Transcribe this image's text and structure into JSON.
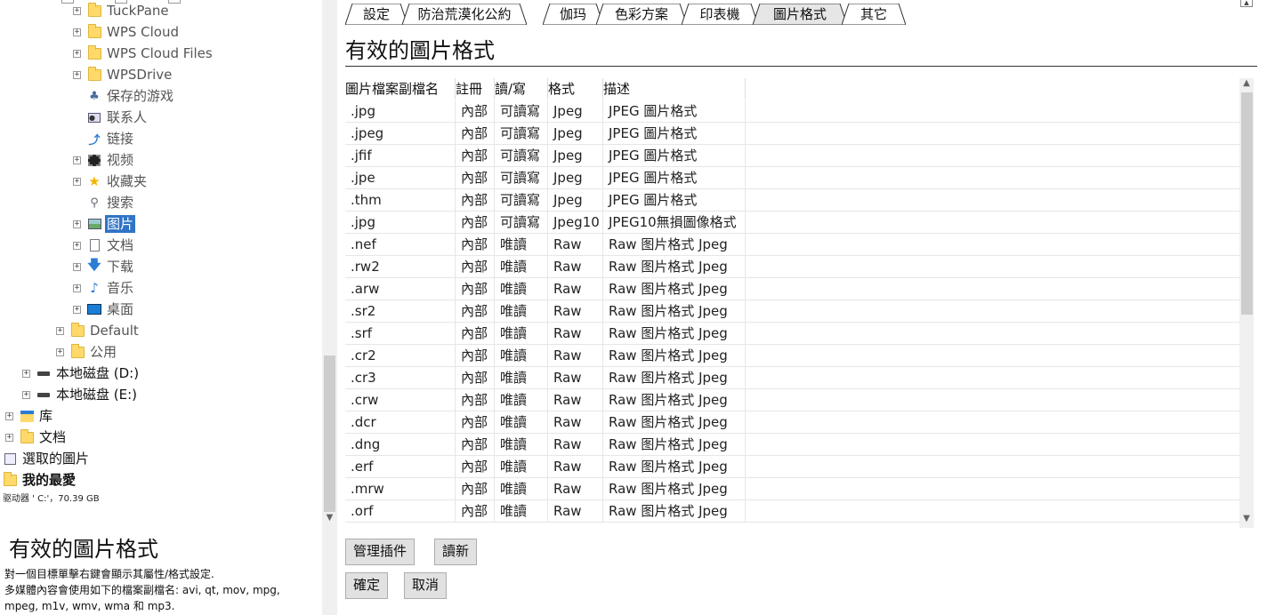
{
  "tree": {
    "items": [
      {
        "label": "TuckPane",
        "icon": "folder-icon"
      },
      {
        "label": "WPS Cloud",
        "icon": "folder-icon"
      },
      {
        "label": "WPS Cloud Files",
        "icon": "folder-icon"
      },
      {
        "label": "WPSDrive",
        "icon": "folder-icon"
      },
      {
        "label": "保存的游戏",
        "icon": "saved-games-icon"
      },
      {
        "label": "联系人",
        "icon": "contacts-icon"
      },
      {
        "label": "链接",
        "icon": "links-icon"
      },
      {
        "label": "视频",
        "icon": "videos-icon"
      },
      {
        "label": "收藏夹",
        "icon": "favorites-star-icon"
      },
      {
        "label": "搜索",
        "icon": "search-icon"
      },
      {
        "label": "图片",
        "icon": "pictures-icon"
      },
      {
        "label": "文档",
        "icon": "documents-icon"
      },
      {
        "label": "下载",
        "icon": "download-icon"
      },
      {
        "label": "音乐",
        "icon": "music-icon"
      },
      {
        "label": "桌面",
        "icon": "desktop-icon"
      },
      {
        "label": "Default",
        "icon": "folder-icon"
      },
      {
        "label": "公用",
        "icon": "folder-icon"
      },
      {
        "label": "本地磁盘 (D:)",
        "icon": "drive-icon"
      },
      {
        "label": "本地磁盘 (E:)",
        "icon": "drive-icon"
      },
      {
        "label": "库",
        "icon": "library-icon"
      },
      {
        "label": "文档",
        "icon": "folder-icon"
      },
      {
        "label": "選取的圖片",
        "icon": "selected-pictures-icon"
      },
      {
        "label": "我的最愛",
        "icon": "folder-icon"
      }
    ],
    "drive_info": "驱动器 ' C:'，70.39 GB"
  },
  "description": {
    "title": "有效的圖片格式",
    "line1": "對一個目標單擊右鍵會顯示其屬性/格式設定.",
    "line2": "多媒體內容會使用如下的檔案副檔名: avi, qt, mov, mpg,",
    "line3": "mpeg, m1v, wmv, wma 和 mp3."
  },
  "tabs": [
    {
      "label": "設定"
    },
    {
      "label": "防治荒漠化公約"
    },
    {
      "label": "伽玛"
    },
    {
      "label": "色彩方案"
    },
    {
      "label": "印表機"
    },
    {
      "label": "圖片格式"
    },
    {
      "label": "其它"
    }
  ],
  "page": {
    "title": "有效的圖片格式"
  },
  "table": {
    "headers": [
      "圖片檔案副檔名",
      "註冊",
      "讀/寫",
      "格式",
      "描述"
    ],
    "rows": [
      [
        ".jpg",
        "內部",
        "可讀寫",
        "Jpeg",
        "JPEG 圖片格式"
      ],
      [
        ".jpeg",
        "內部",
        "可讀寫",
        "Jpeg",
        "JPEG 圖片格式"
      ],
      [
        ".jfif",
        "內部",
        "可讀寫",
        "Jpeg",
        "JPEG 圖片格式"
      ],
      [
        ".jpe",
        "內部",
        "可讀寫",
        "Jpeg",
        "JPEG 圖片格式"
      ],
      [
        ".thm",
        "內部",
        "可讀寫",
        "Jpeg",
        "JPEG 圖片格式"
      ],
      [
        ".jpg",
        "內部",
        "可讀寫",
        "Jpeg10",
        "JPEG10無損圖像格式"
      ],
      [
        ".nef",
        "內部",
        "唯讀",
        "Raw",
        "Raw 图片格式 Jpeg"
      ],
      [
        ".rw2",
        "內部",
        "唯讀",
        "Raw",
        "Raw 图片格式 Jpeg"
      ],
      [
        ".arw",
        "內部",
        "唯讀",
        "Raw",
        "Raw 图片格式 Jpeg"
      ],
      [
        ".sr2",
        "內部",
        "唯讀",
        "Raw",
        "Raw 图片格式 Jpeg"
      ],
      [
        ".srf",
        "內部",
        "唯讀",
        "Raw",
        "Raw 图片格式 Jpeg"
      ],
      [
        ".cr2",
        "內部",
        "唯讀",
        "Raw",
        "Raw 图片格式 Jpeg"
      ],
      [
        ".cr3",
        "內部",
        "唯讀",
        "Raw",
        "Raw 图片格式 Jpeg"
      ],
      [
        ".crw",
        "內部",
        "唯讀",
        "Raw",
        "Raw 图片格式 Jpeg"
      ],
      [
        ".dcr",
        "內部",
        "唯讀",
        "Raw",
        "Raw 图片格式 Jpeg"
      ],
      [
        ".dng",
        "內部",
        "唯讀",
        "Raw",
        "Raw 图片格式 Jpeg"
      ],
      [
        ".erf",
        "內部",
        "唯讀",
        "Raw",
        "Raw 图片格式 Jpeg"
      ],
      [
        ".mrw",
        "內部",
        "唯讀",
        "Raw",
        "Raw 图片格式 Jpeg"
      ],
      [
        ".orf",
        "內部",
        "唯讀",
        "Raw",
        "Raw 图片格式 Jpeg"
      ]
    ]
  },
  "buttons": {
    "manage_plugins": "管理插件",
    "refresh": "讀新",
    "ok": "確定",
    "cancel": "取消"
  },
  "colors": {
    "selection": "#3174c6",
    "folder": "#ffd96a"
  }
}
